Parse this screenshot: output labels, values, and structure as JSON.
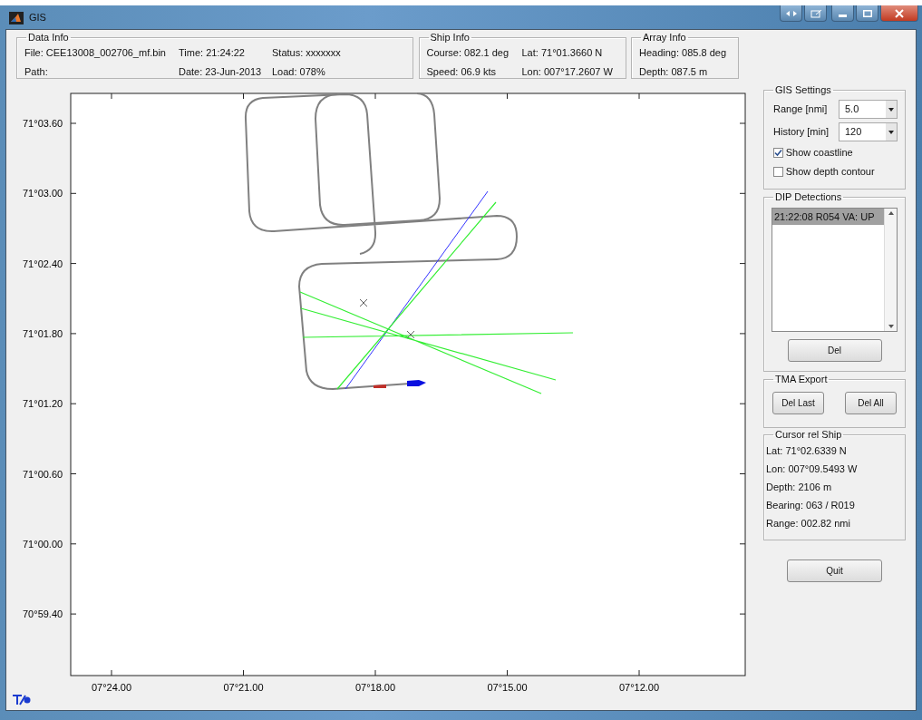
{
  "window": {
    "title": "GIS"
  },
  "data_info": {
    "title": "Data Info",
    "fields": [
      "File: CEE13008_002706_mf.bin",
      "Time: 21:24:22",
      "Status: xxxxxxx",
      "Path:",
      "Date: 23-Jun-2013",
      "Load: 078%"
    ]
  },
  "ship_info": {
    "title": "Ship Info",
    "fields": [
      "Course: 082.1 deg",
      "Lat: 71°01.3660 N",
      "Speed: 06.9 kts",
      "Lon: 007°17.2607 W"
    ]
  },
  "array_info": {
    "title": "Array Info",
    "fields": [
      "Heading: 085.8 deg",
      "Depth: 087.5 m"
    ]
  },
  "map": {
    "y_ticks": [
      "71°03.60",
      "71°03.00",
      "71°02.40",
      "71°01.80",
      "71°01.20",
      "71°00.60",
      "71°00.00",
      "70°59.40"
    ],
    "x_ticks": [
      "07°24.00",
      "07°21.00",
      "07°18.00",
      "07°15.00",
      "07°12.00"
    ]
  },
  "gis_settings": {
    "title": "GIS Settings",
    "range": {
      "label": "Range [nmi]",
      "value": "5.0"
    },
    "history": {
      "label": "History [min]",
      "value": "120"
    },
    "checkboxes": [
      {
        "label": "Show coastline",
        "checked": true
      },
      {
        "label": "Show depth contour",
        "checked": false
      }
    ]
  },
  "dip_detections": {
    "title": "DIP Detections",
    "items": [
      {
        "text": "21:22:08 R054 VA: UP",
        "selected": true
      }
    ],
    "button": "Del"
  },
  "tma_export": {
    "title": "TMA Export",
    "buttons": [
      "Del Last",
      "Del All"
    ]
  },
  "cursor_rel_ship": {
    "title": "Cursor rel Ship",
    "lines": [
      "Lat: 71°02.6339 N",
      "Lon: 007°09.5493 W",
      "Depth: 2106 m",
      "Bearing: 063 / R019",
      "Range: 002.82 nmi"
    ]
  },
  "quit_button": "Quit"
}
